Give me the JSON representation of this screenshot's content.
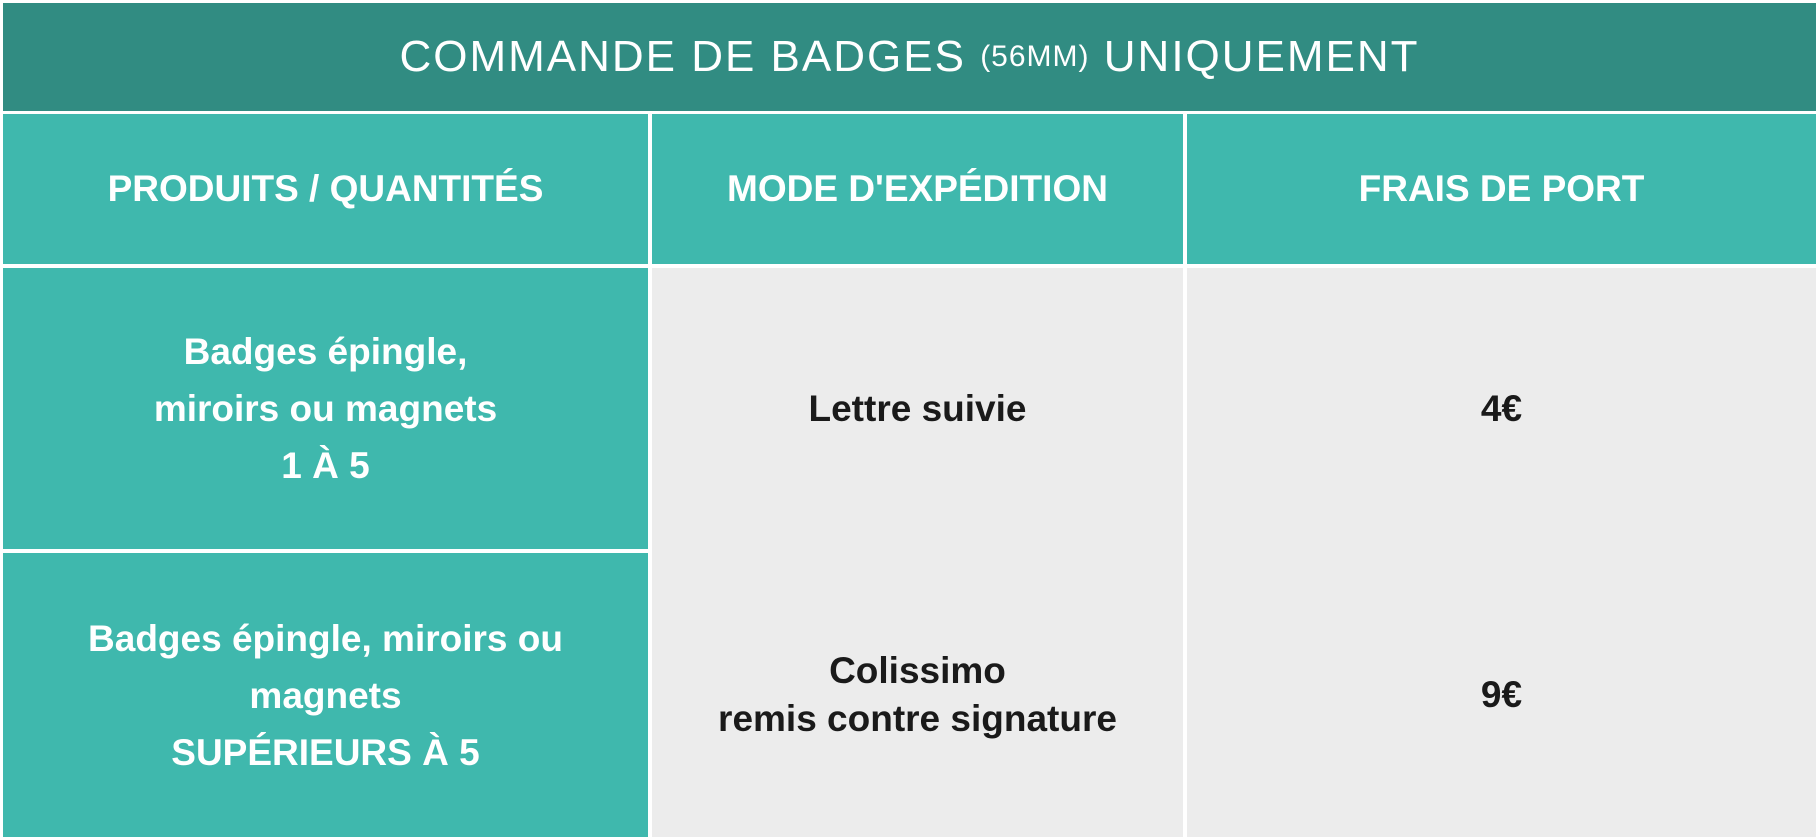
{
  "title": {
    "main_before": "COMMANDE DE BADGES",
    "size_note": "(56MM)",
    "main_after": "UNIQUEMENT"
  },
  "headers": {
    "products": "PRODUITS / QUANTITÉS",
    "shipping_mode": "MODE D'EXPÉDITION",
    "shipping_cost": "FRAIS DE PORT"
  },
  "rows": [
    {
      "product_lines": [
        "Badges épingle,",
        "miroirs ou magnets",
        "1 À 5"
      ],
      "mode_lines": [
        "Lettre suivie"
      ],
      "price": "4€"
    },
    {
      "product_lines": [
        "Badges épingle, miroirs ou",
        "magnets",
        "SUPÉRIEURS À 5"
      ],
      "mode_lines": [
        "Colissimo",
        "remis contre signature"
      ],
      "price": "9€"
    }
  ],
  "colors": {
    "title_bg": "#318c82",
    "header_bg": "#3fb8ad",
    "body_bg": "#ececec",
    "text_dark": "#1a1a1a",
    "text_light": "#ffffff"
  }
}
